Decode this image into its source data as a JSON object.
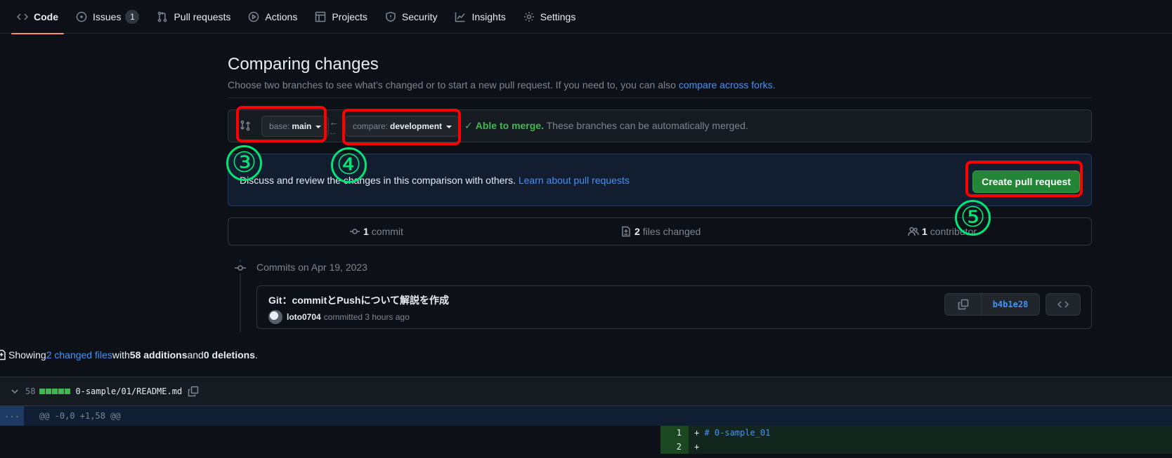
{
  "nav": {
    "items": [
      {
        "label": "Code",
        "icon": "code-icon"
      },
      {
        "label": "Issues",
        "icon": "issue-icon",
        "count": "1"
      },
      {
        "label": "Pull requests",
        "icon": "pull-request-icon"
      },
      {
        "label": "Actions",
        "icon": "play-icon"
      },
      {
        "label": "Projects",
        "icon": "table-icon"
      },
      {
        "label": "Security",
        "icon": "shield-icon"
      },
      {
        "label": "Insights",
        "icon": "graph-icon"
      },
      {
        "label": "Settings",
        "icon": "gear-icon"
      }
    ],
    "active": "Code"
  },
  "header": {
    "title": "Comparing changes",
    "subtitle": "Choose two branches to see what’s changed or to start a new pull request. If you need to, you can also ",
    "subtitle_link": "compare across forks",
    "subtitle_end": "."
  },
  "range": {
    "base_prefix": "base:",
    "base_branch": "main",
    "compare_prefix": "compare:",
    "compare_branch": "development",
    "arrow": "←",
    "dots": "...",
    "merge_ok": "Able to merge.",
    "merge_text": " These branches can be automatically merged."
  },
  "annotations": {
    "step3": "③",
    "step4": "④",
    "step5": "⑤",
    "highlight_color": "#ff0000",
    "number_color": "#00e676"
  },
  "discuss": {
    "text": "Discuss and review the changes in this comparison with others. ",
    "link": "Learn about pull requests",
    "button": "Create pull request"
  },
  "numbers": {
    "commits_count": "1",
    "commits_label": "commit",
    "files_count": "2",
    "files_label": "files changed",
    "contributors_count": "1",
    "contributors_label": "contributor"
  },
  "commits": {
    "date_heading": "Commits on Apr 19, 2023",
    "message": "Git：commitとPushについて解説を作成",
    "author": "loto0704",
    "meta": "committed 3 hours ago",
    "sha": "b4b1e28"
  },
  "summary": {
    "prefix": "Showing ",
    "files_link": "2 changed files",
    "with": " with ",
    "additions": "58 additions",
    "and": " and ",
    "deletions": "0 deletions",
    "end": "."
  },
  "file": {
    "count": "58",
    "name": "0-sample/01/README.md",
    "hunk_expand": "...",
    "hunk": "@@ -0,0 +1,58 @@",
    "lines": [
      {
        "num": "1",
        "prefix": "+ ",
        "code": "# 0-sample_01"
      },
      {
        "num": "2",
        "prefix": "+",
        "code": ""
      }
    ]
  },
  "colors": {
    "accent_link": "#4493f8",
    "success": "#3fb950",
    "button_green": "#238636",
    "nav_underline": "#fd8c73"
  }
}
